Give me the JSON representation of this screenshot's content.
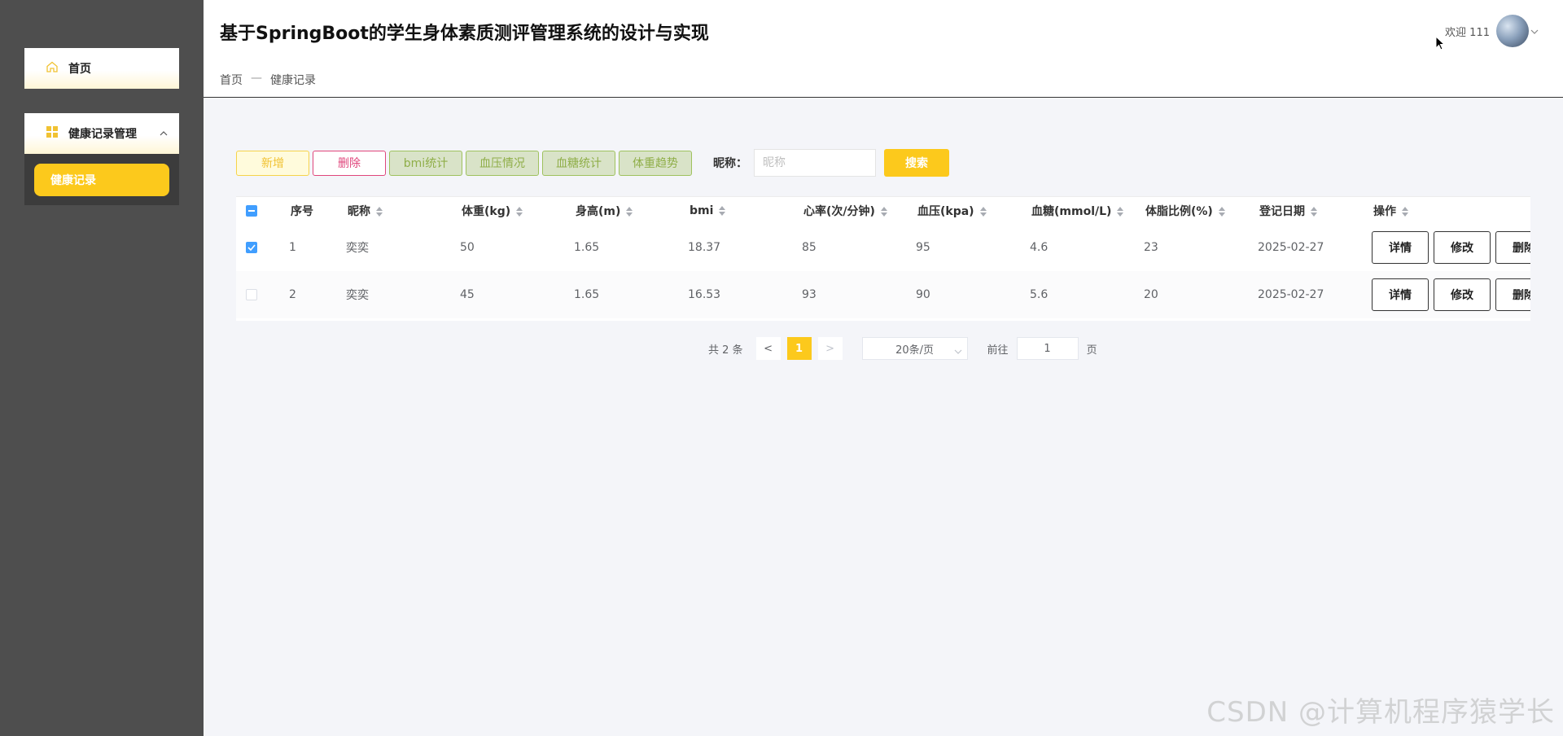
{
  "app": {
    "title": "基于SpringBoot的学生身体素质测评管理系统的设计与实现"
  },
  "sidebar": {
    "home_label": "首页",
    "group_label": "健康记录管理",
    "sub_items": [
      {
        "label": "健康记录",
        "active": true
      }
    ]
  },
  "breadcrumb": {
    "home": "首页",
    "separator": "—",
    "current": "健康记录"
  },
  "user": {
    "welcome": "欢迎 111"
  },
  "toolbar": {
    "add_label": "新增",
    "delete_label": "删除",
    "bmi_label": "bmi统计",
    "bp_label": "血压情况",
    "sugar_label": "血糖统计",
    "weight_label": "体重趋势",
    "search_label": "昵称：",
    "search_placeholder": "昵称",
    "search_button": "搜索"
  },
  "table": {
    "columns": [
      "序号",
      "昵称",
      "体重(kg)",
      "身高(m)",
      "bmi",
      "心率(次/分钟)",
      "血压(kpa)",
      "血糖(mmol/L)",
      "体脂比例(%)",
      "登记日期",
      "操作"
    ],
    "rows": [
      {
        "checked": true,
        "no": "1",
        "nickname": "奕奕",
        "weight": "50",
        "height": "1.65",
        "bmi": "18.37",
        "heart_rate": "85",
        "bp": "95",
        "sugar": "4.6",
        "fat": "23",
        "date": "2025-02-27"
      },
      {
        "checked": false,
        "no": "2",
        "nickname": "奕奕",
        "weight": "45",
        "height": "1.65",
        "bmi": "16.53",
        "heart_rate": "93",
        "bp": "90",
        "sugar": "5.6",
        "fat": "20",
        "date": "2025-02-27"
      }
    ],
    "actions": {
      "detail": "详情",
      "edit": "修改",
      "delete": "删除"
    }
  },
  "pagination": {
    "total_text": "共 2 条",
    "prev": "<",
    "current_page": "1",
    "next": ">",
    "page_size": "20条/页",
    "goto_label": "前往",
    "goto_value": "1",
    "page_suffix": "页"
  },
  "watermark": "CSDN @计算机程序猿学长",
  "colors": {
    "accent": "#fcc91c",
    "sidebar": "#4e4e4e",
    "danger": "#e0467c",
    "stat": "#9fc25e",
    "checkbox": "#409eff"
  }
}
